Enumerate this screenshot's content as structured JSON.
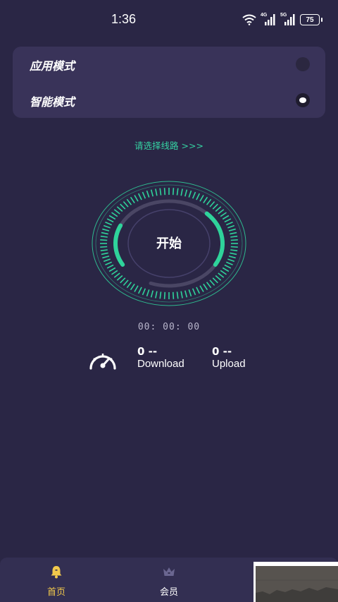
{
  "status_bar": {
    "time": "1:36",
    "signal_1": "4G",
    "signal_2": "5G",
    "battery": "75",
    "icons": [
      "wifi-icon",
      "signal-4g-icon",
      "signal-5g-icon",
      "battery-icon"
    ]
  },
  "modes": {
    "items": [
      {
        "label": "应用模式",
        "selected": false
      },
      {
        "label": "智能模式",
        "selected": true
      }
    ]
  },
  "route_link": "请选择线路 >>>",
  "start_button": {
    "label": "开始",
    "progress_arc_color": "#2fd39b"
  },
  "timer": "00: 00: 00",
  "stats": {
    "download": {
      "value": "0 --",
      "label": "Download"
    },
    "upload": {
      "value": "0 --",
      "label": "Upload"
    },
    "icon": "speedometer-icon"
  },
  "bottom_nav": {
    "items": [
      {
        "label": "首页",
        "icon": "bell-icon",
        "active": true
      },
      {
        "label": "会员",
        "icon": "crown-icon",
        "active": false
      }
    ]
  },
  "colors": {
    "background": "#2a2645",
    "card": "#393359",
    "accent_green": "#35d3a3",
    "nav_active": "#f2c94c",
    "nav_inactive": "#ffffff"
  }
}
